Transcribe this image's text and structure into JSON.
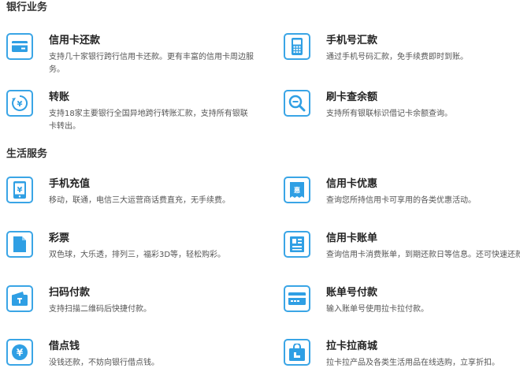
{
  "sections": [
    {
      "title": "银行业务",
      "items": [
        {
          "title": "信用卡还款",
          "desc": "支持几十家银行跨行信用卡还款。更有丰富的信用卡周边服务。",
          "icon": "credit-card-icon"
        },
        {
          "title": "手机号汇款",
          "desc": "通过手机号码汇款，免手续费即时到账。",
          "icon": "mobile-phone-icon"
        },
        {
          "title": "转账",
          "desc": "支持18家主要银行全国异地跨行转账汇款，支持所有银联卡转出。",
          "icon": "yuan-transfer-icon"
        },
        {
          "title": "刷卡查余额",
          "desc": "支持所有银联标识借记卡余额查询。",
          "icon": "magnifier-icon"
        }
      ]
    },
    {
      "title": "生活服务",
      "items": [
        {
          "title": "手机充值",
          "desc": "移动，联通，电信三大运营商话费直充，无手续费。",
          "icon": "phone-recharge-icon"
        },
        {
          "title": "信用卡优惠",
          "desc": "查询您所持信用卡可享用的各类优惠活动。",
          "icon": "coupon-icon"
        },
        {
          "title": "彩票",
          "desc": "双色球，大乐透，排列三，福彩3D等，轻松购彩。",
          "icon": "lottery-ticket-icon"
        },
        {
          "title": "信用卡账单",
          "desc": "查询信用卡消费账单，到期还款日等信息。还可快速还款。",
          "icon": "bill-icon"
        },
        {
          "title": "扫码付款",
          "desc": "支持扫描二维码后快捷付款。",
          "icon": "qr-wallet-icon"
        },
        {
          "title": "账单号付款",
          "desc": "输入账单号使用拉卡拉付款。",
          "icon": "card-pay-icon"
        },
        {
          "title": "借点钱",
          "desc": "没钱还款，不妨向银行借点钱。",
          "icon": "yuan-coin-icon"
        },
        {
          "title": "拉卡拉商城",
          "desc": "拉卡拉产品及各类生活用品在线选购，立享折扣。",
          "icon": "shopping-bag-icon"
        }
      ]
    }
  ],
  "colors": {
    "accent": "#3aa5e6",
    "accent_fill": "#2f9fe4"
  }
}
